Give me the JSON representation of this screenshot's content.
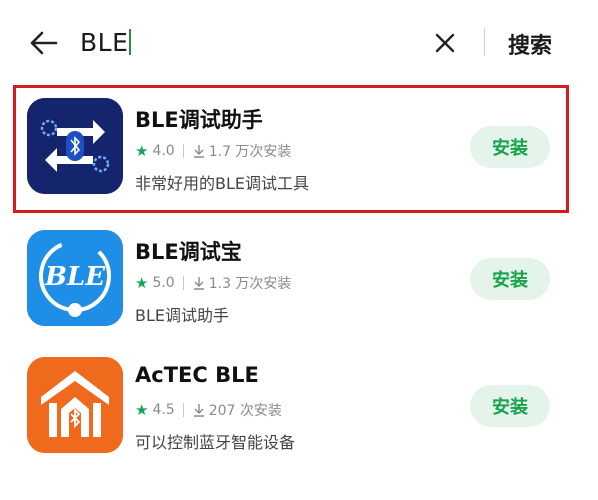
{
  "search": {
    "query": "BLE",
    "button_label": "搜索"
  },
  "apps": [
    {
      "name": "BLE调试助手",
      "rating": "4.0",
      "installs": "1.7 万次安装",
      "description": "非常好用的BLE调试工具",
      "install_label": "安装"
    },
    {
      "name": "BLE调试宝",
      "rating": "5.0",
      "installs": "1.3 万次安装",
      "description": "BLE调试助手",
      "install_label": "安装",
      "icon_text": "BLE"
    },
    {
      "name": "AcTEC BLE",
      "rating": "4.5",
      "installs": "207 次安装",
      "description": "可以控制蓝牙智能设备",
      "install_label": "安装"
    }
  ],
  "colors": {
    "accent_green": "#17a24b",
    "install_bg": "#e4f4ea",
    "highlight_red": "#d71920",
    "icon1_bg": "#14256e",
    "icon2_bg": "#1e8ee6",
    "icon3_bg": "#f06a1d"
  },
  "icons": [
    "back-arrow-icon",
    "clear-icon",
    "star-icon",
    "download-icon",
    "bluetooth-icon"
  ]
}
